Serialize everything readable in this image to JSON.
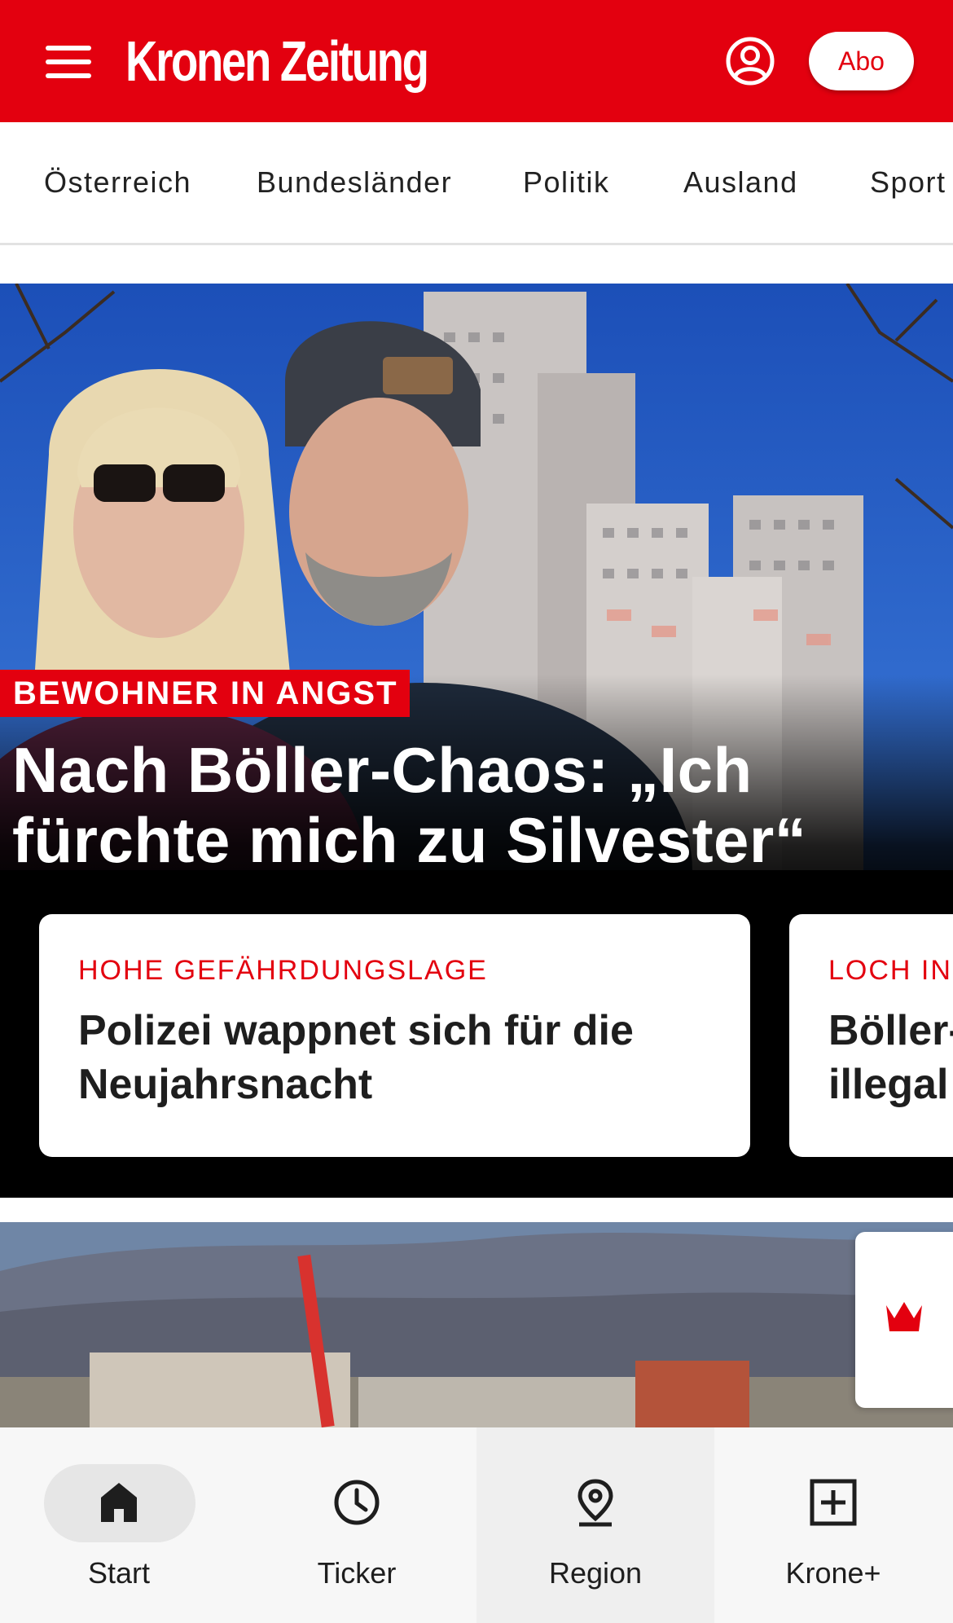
{
  "header": {
    "logo_text": "Kronen Zeitung",
    "abo_label": "Abo",
    "brand_color": "#e3000f"
  },
  "nav": {
    "items": [
      {
        "label": "Österreich"
      },
      {
        "label": "Bundesländer"
      },
      {
        "label": "Politik"
      },
      {
        "label": "Ausland"
      },
      {
        "label": "Sport"
      }
    ]
  },
  "hero": {
    "kicker": "BEWOHNER IN ANGST",
    "headline": "Nach Böller-Chaos: „Ich fürchte mich zu Silvester“",
    "cards": [
      {
        "kicker": "HOHE GEFÄHRDUNGSLAGE",
        "title": "Polizei wappnet sich für die Neujahrsnacht"
      },
      {
        "kicker": "LOCH IN",
        "title": "Böller- illegal"
      }
    ]
  },
  "bottom_nav": {
    "tabs": [
      {
        "label": "Start",
        "icon": "home-icon",
        "active": true
      },
      {
        "label": "Ticker",
        "icon": "clock-icon"
      },
      {
        "label": "Region",
        "icon": "location-pin-icon"
      },
      {
        "label": "Krone+",
        "icon": "plus-box-icon"
      }
    ]
  }
}
